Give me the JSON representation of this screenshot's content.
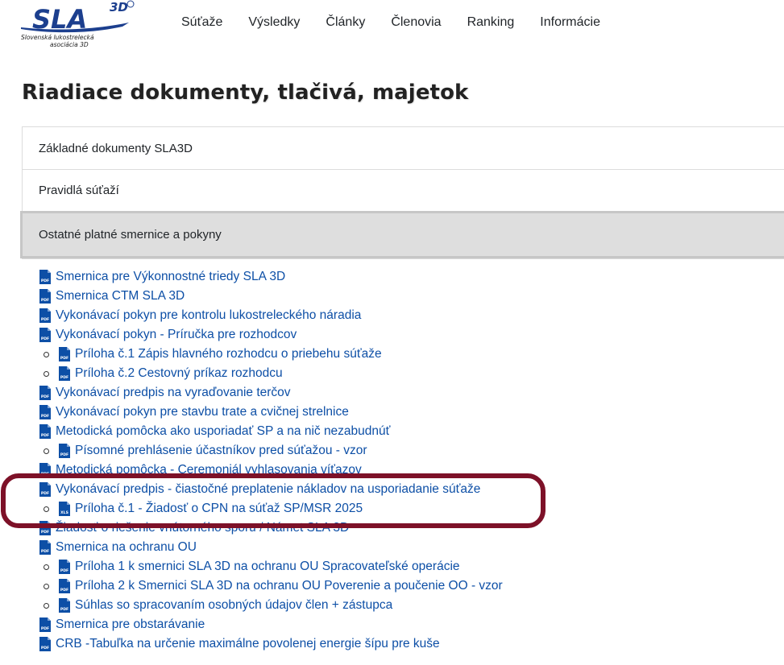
{
  "logo": {
    "text": "SLA",
    "superscript": "3D",
    "line1": "Slovenská lukostrelecká",
    "line2": "asociácia 3D"
  },
  "nav": [
    "Súťaže",
    "Výsledky",
    "Články",
    "Členovia",
    "Ranking",
    "Informácie"
  ],
  "page_title": "Riadiace dokumenty, tlačivá, majetok",
  "accordion": [
    {
      "label": "Základné dokumenty SLA3D",
      "active": false
    },
    {
      "label": "Pravidlá súťaží",
      "active": false
    },
    {
      "label": "Ostatné platné smernice a pokyny",
      "active": true
    }
  ],
  "documents": [
    {
      "label": "Smernica pre Výkonnostné triedy SLA 3D",
      "icon": "pdf-icon",
      "sub": false
    },
    {
      "label": "Smernica CTM SLA 3D",
      "icon": "pdf-icon",
      "sub": false
    },
    {
      "label": "Vykonávací pokyn pre kontrolu lukostreleckého náradia",
      "icon": "pdf-icon",
      "sub": false
    },
    {
      "label": "Vykonávací pokyn - Príručka pre rozhodcov",
      "icon": "pdf-icon",
      "sub": false
    },
    {
      "label": "Príloha č.1 Zápis hlavného rozhodcu o priebehu súťaže",
      "icon": "pdf-icon",
      "sub": true
    },
    {
      "label": "Príloha č.2 Cestovný príkaz rozhodcu",
      "icon": "pdf-icon",
      "sub": true
    },
    {
      "label": "Vykonávací predpis na vyraďovanie terčov",
      "icon": "pdf-icon",
      "sub": false
    },
    {
      "label": "Vykonávací pokyn pre stavbu trate a cvičnej strelnice",
      "icon": "pdf-icon",
      "sub": false
    },
    {
      "label": "Metodická pomôcka ako usporiadať SP a na nič nezabudnúť",
      "icon": "pdf-icon",
      "sub": false
    },
    {
      "label": "Písomné prehlásenie účastníkov pred súťažou - vzor",
      "icon": "pdf-icon",
      "sub": true
    },
    {
      "label": "Metodická pomôcka - Ceremoniál vyhlasovania víťazov",
      "icon": "pdf-icon",
      "sub": false
    },
    {
      "label": "Vykonávací predpis - čiastočné preplatenie nákladov na usporiadanie súťaže",
      "icon": "pdf-icon",
      "sub": false
    },
    {
      "label": "Príloha č.1 - Žiadosť o CPN na súťaž SP/MSR 2025",
      "icon": "xls-icon",
      "sub": true
    },
    {
      "label": "Žiadosť o riešenie vnútorného sporu / Námet SLA 3D",
      "icon": "pdf-icon",
      "sub": false
    },
    {
      "label": "Smernica na ochranu OU",
      "icon": "pdf-icon",
      "sub": false
    },
    {
      "label": "Príloha 1 k smernici SLA 3D na ochranu OU Spracovateľské operácie",
      "icon": "pdf-icon",
      "sub": true
    },
    {
      "label": "Príloha 2 k Smernici SLA 3D na ochranu OU Poverenie a poučenie OO - vzor",
      "icon": "pdf-icon",
      "sub": true
    },
    {
      "label": "Súhlas so spracovaním osobných údajov člen + zástupca",
      "icon": "pdf-icon",
      "sub": true
    },
    {
      "label": "Smernica pre obstarávanie",
      "icon": "pdf-icon",
      "sub": false
    },
    {
      "label": "CRB -Tabuľka na určenie maximálne povolenej energie šípu pre kuše",
      "icon": "pdf-icon",
      "sub": false
    }
  ],
  "colors": {
    "link": "#0d4fa6",
    "icon": "#0d4fa6",
    "highlight": "#7d1128",
    "logo": "#1c3f8e"
  }
}
